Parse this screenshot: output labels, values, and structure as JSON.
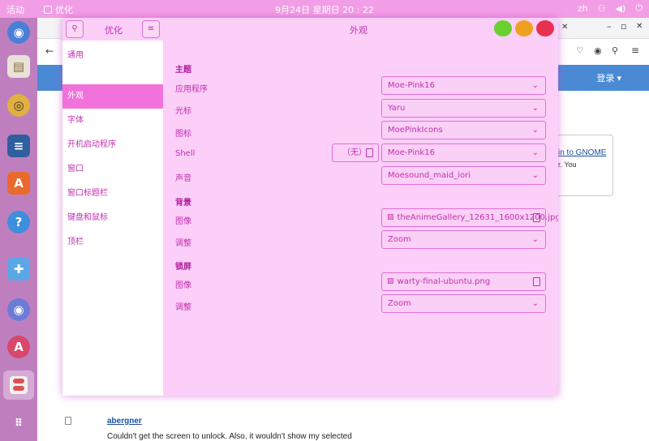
{
  "topbar": {
    "activities": "活动",
    "app_name": "优化",
    "clock": "9月24日 星期日  20 : 22",
    "input_method": "zh",
    "tray_icons": [
      "network-icon",
      "volume-icon",
      "power-icon"
    ]
  },
  "dock": {
    "items": [
      "web-browser-icon",
      "file-manager-icon",
      "music-player-icon",
      "text-editor-icon",
      "app-store-icon",
      "help-icon",
      "extensions-icon",
      "disc-icon",
      "software-updater-icon",
      "tweaks-icon",
      "show-apps-icon"
    ]
  },
  "browser": {
    "login": "登录 ▾",
    "card_link": "in to GNOME",
    "card_text": "r. You",
    "comment_user": "abergner",
    "comment_text": "Couldn't get the screen to unlock. Also, it wouldn't show my selected"
  },
  "tweaks": {
    "app_title": "优化",
    "page_title": "外观",
    "sidebar": [
      {
        "label": "通用",
        "selected": false
      },
      {
        "label": "外观",
        "selected": true
      },
      {
        "label": "字体",
        "selected": false
      },
      {
        "label": "开机启动程序",
        "selected": false
      },
      {
        "label": "窗口",
        "selected": false
      },
      {
        "label": "窗口标题栏",
        "selected": false
      },
      {
        "label": "键盘和鼠标",
        "selected": false
      },
      {
        "label": "顶栏",
        "selected": false
      }
    ],
    "sections": {
      "themes": "主题",
      "background": "背景",
      "lockscreen": "锁屏"
    },
    "themes": {
      "applications": {
        "label": "应用程序",
        "value": "Moe-Pink16"
      },
      "cursor": {
        "label": "光标",
        "value": "Yaru"
      },
      "icons": {
        "label": "图标",
        "value": "MoePinkIcons"
      },
      "shell": {
        "label": "Shell",
        "value": "Moe-Pink16",
        "extra": "（无）"
      },
      "sound": {
        "label": "声音",
        "value": "Moesound_maid_iori"
      }
    },
    "background": {
      "image": {
        "label": "图像",
        "value": "theAnimeGallery_12631_1600x1200.jpg"
      },
      "adjust": {
        "label": "调整",
        "value": "Zoom"
      }
    },
    "lockscreen": {
      "image": {
        "label": "图像",
        "value": "warty-final-ubuntu.png"
      },
      "adjust": {
        "label": "调整",
        "value": "Zoom"
      }
    },
    "colors": {
      "accent": "#c030b0",
      "selected": "#f272dc",
      "background": "#fbcff8"
    }
  }
}
